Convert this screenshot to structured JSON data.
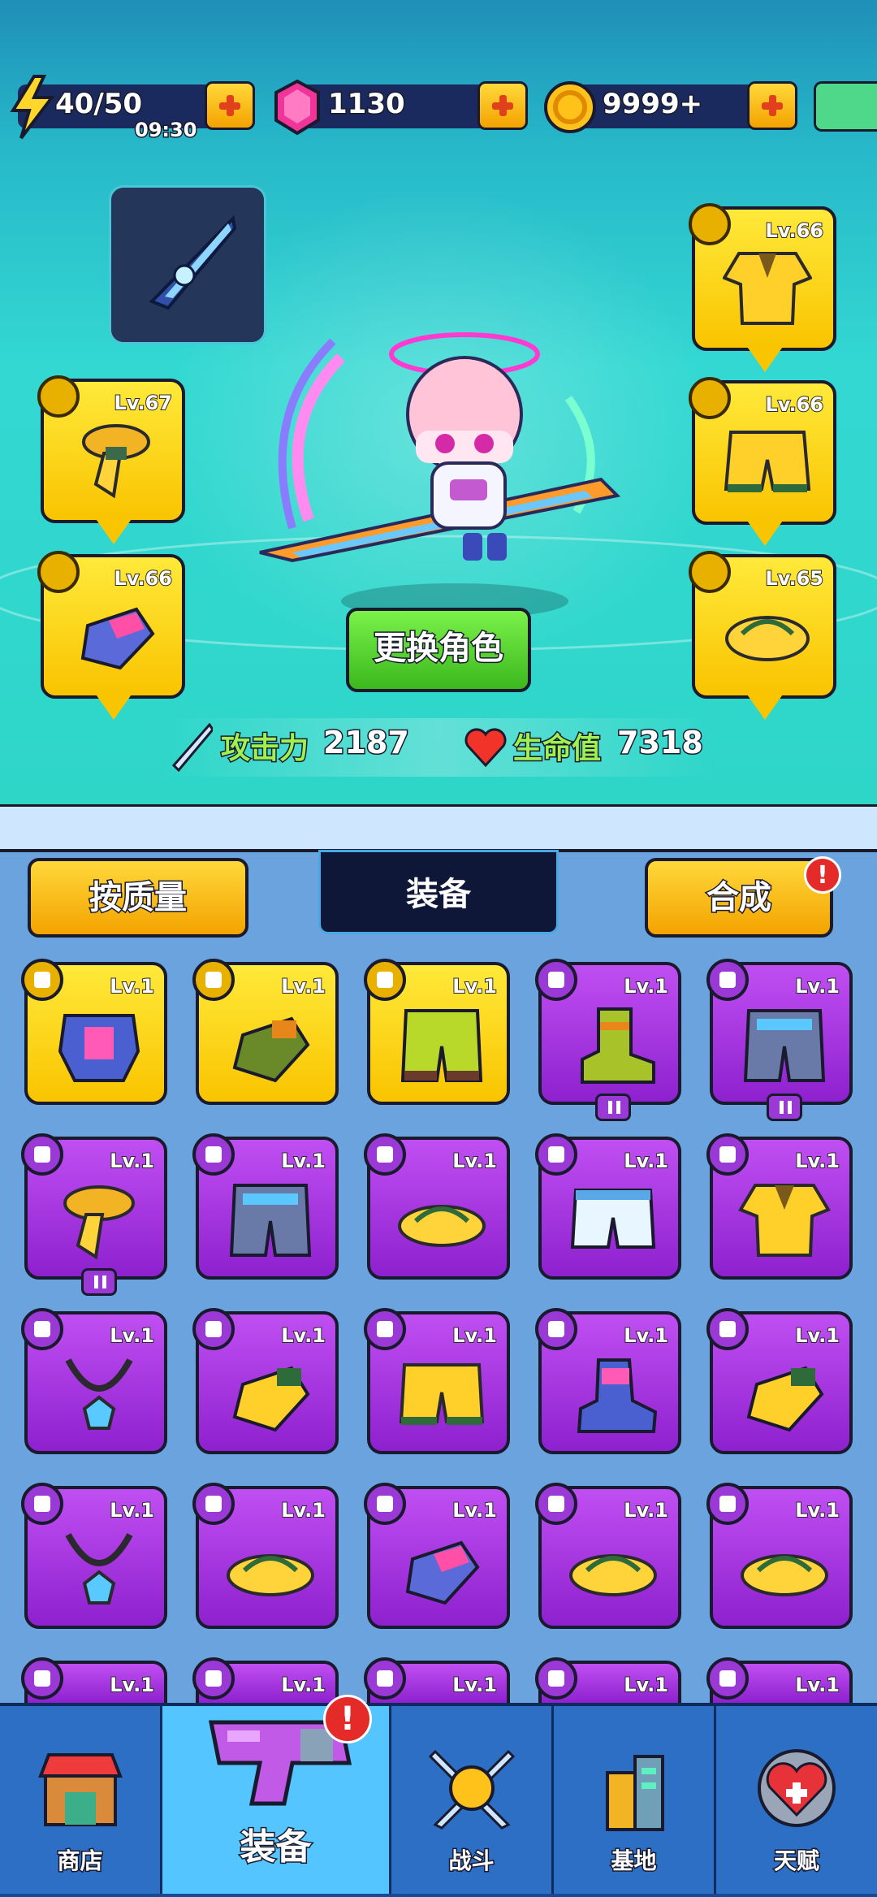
{
  "resources": {
    "energy": {
      "value": "40/50",
      "timer": "09:30",
      "icon": "lightning-icon"
    },
    "gems": {
      "value": "1130",
      "icon": "pink-gem-icon"
    },
    "coins": {
      "value": "9999+",
      "icon": "gold-coin-icon"
    }
  },
  "character": {
    "change_button": "更换角色",
    "attack": {
      "label": "攻击力",
      "value": "2187",
      "icon": "sword-icon"
    },
    "health": {
      "label": "生命值",
      "value": "7318",
      "icon": "heart-icon"
    }
  },
  "equipped": {
    "weapon": {
      "icon": "blade-icon"
    },
    "necklace": {
      "level": "Lv.67",
      "icon": "scarf-icon"
    },
    "gloves": {
      "level": "Lv.66",
      "icon": "gauntlet-icon"
    },
    "armor": {
      "level": "Lv.66",
      "icon": "hawaiian-shirt-icon"
    },
    "pants": {
      "level": "Lv.66",
      "icon": "shorts-icon"
    },
    "shoes": {
      "level": "Lv.65",
      "icon": "flip-flop-icon"
    }
  },
  "panel": {
    "sort_button": "按质量",
    "title": "装备",
    "merge_button": "合成",
    "alert": "!"
  },
  "inventory": [
    {
      "level": "Lv.1",
      "rarity": "gold",
      "icon": "chest-armor-icon",
      "pause": false
    },
    {
      "level": "Lv.1",
      "rarity": "gold",
      "icon": "glove-icon",
      "pause": false
    },
    {
      "level": "Lv.1",
      "rarity": "gold",
      "icon": "camo-pants-icon",
      "pause": false
    },
    {
      "level": "Lv.1",
      "rarity": "purple",
      "icon": "boot-icon",
      "pause": true
    },
    {
      "level": "Lv.1",
      "rarity": "purple",
      "icon": "armored-pants-icon",
      "pause": true
    },
    {
      "level": "Lv.1",
      "rarity": "purple",
      "icon": "scarf-icon",
      "pause": true
    },
    {
      "level": "Lv.1",
      "rarity": "purple",
      "icon": "armored-pants-icon",
      "pause": false
    },
    {
      "level": "Lv.1",
      "rarity": "purple",
      "icon": "flip-flop-icon",
      "pause": false
    },
    {
      "level": "Lv.1",
      "rarity": "purple",
      "icon": "white-shorts-icon",
      "pause": false
    },
    {
      "level": "Lv.1",
      "rarity": "purple",
      "icon": "hawaiian-shirt-icon",
      "pause": false
    },
    {
      "level": "Lv.1",
      "rarity": "purple",
      "icon": "necklace-icon",
      "pause": false
    },
    {
      "level": "Lv.1",
      "rarity": "purple",
      "icon": "yellow-glove-icon",
      "pause": false
    },
    {
      "level": "Lv.1",
      "rarity": "purple",
      "icon": "shorts-icon",
      "pause": false
    },
    {
      "level": "Lv.1",
      "rarity": "purple",
      "icon": "sneaker-icon",
      "pause": false
    },
    {
      "level": "Lv.1",
      "rarity": "purple",
      "icon": "yellow-glove-icon",
      "pause": false
    },
    {
      "level": "Lv.1",
      "rarity": "purple",
      "icon": "necklace-icon",
      "pause": false
    },
    {
      "level": "Lv.1",
      "rarity": "purple",
      "icon": "flip-flop-icon",
      "pause": false
    },
    {
      "level": "Lv.1",
      "rarity": "purple",
      "icon": "gauntlet-icon",
      "pause": false
    },
    {
      "level": "Lv.1",
      "rarity": "purple",
      "icon": "flip-flop-icon",
      "pause": false
    },
    {
      "level": "Lv.1",
      "rarity": "purple",
      "icon": "flip-flop-icon",
      "pause": false
    },
    {
      "level": "Lv.1",
      "rarity": "purple",
      "icon": "glove-icon",
      "pause": false
    },
    {
      "level": "Lv.1",
      "rarity": "purple",
      "icon": "glove-icon",
      "pause": false
    },
    {
      "level": "Lv.1",
      "rarity": "purple",
      "icon": "flip-flop-icon",
      "pause": false
    },
    {
      "level": "Lv.1",
      "rarity": "purple",
      "icon": "necklace-icon",
      "pause": false
    },
    {
      "level": "Lv.1",
      "rarity": "purple",
      "icon": "necklace-icon",
      "pause": false
    }
  ],
  "nav": [
    {
      "label": "商店",
      "icon": "shop-icon",
      "active": false
    },
    {
      "label": "装备",
      "icon": "gun-icon",
      "active": true,
      "alert": "!"
    },
    {
      "label": "战斗",
      "icon": "battle-icon",
      "active": false
    },
    {
      "label": "基地",
      "icon": "base-building-icon",
      "active": false
    },
    {
      "label": "天赋",
      "icon": "talent-heart-icon",
      "active": false
    }
  ],
  "colors": {
    "gold_slot": "#f9c400",
    "purple_slot": "#a233dd",
    "accent_green": "#9ef24f",
    "nav_active": "#54c5ff"
  }
}
